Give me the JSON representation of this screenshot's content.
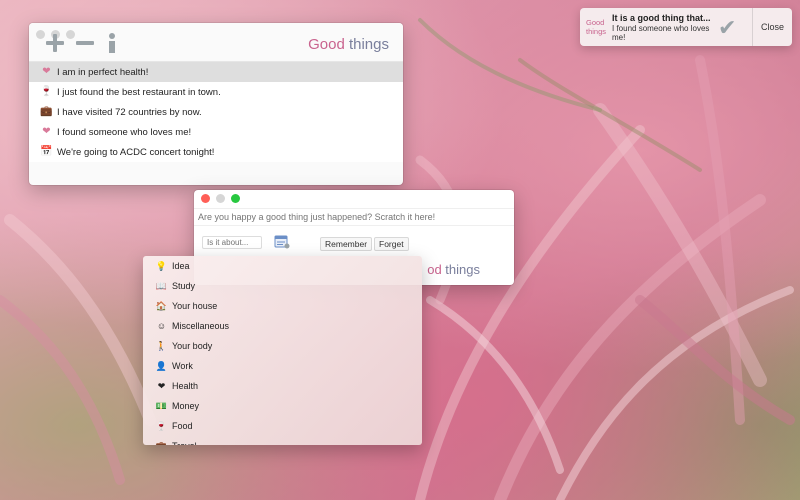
{
  "app": {
    "brand_good": "Good",
    "brand_things": " things"
  },
  "main_window": {
    "entries": [
      {
        "icon": "heart-icon",
        "glyph": "❤",
        "color": "#d97a9a",
        "text": "I am in perfect health!",
        "selected": true
      },
      {
        "icon": "wine-glass-icon",
        "glyph": "🍷",
        "color": "#c9638e",
        "text": "I just found the best restaurant in town.",
        "selected": false
      },
      {
        "icon": "suitcase-icon",
        "glyph": "💼",
        "color": "#c08a90",
        "text": "I have visited 72 countries by now.",
        "selected": false
      },
      {
        "icon": "heart-icon",
        "glyph": "❤",
        "color": "#d97a9a",
        "text": "I found someone who loves me!",
        "selected": false
      },
      {
        "icon": "calendar-icon",
        "glyph": "📅",
        "color": "#6b8fc7",
        "text": "We're going to ACDC concert tonight!",
        "selected": false
      }
    ]
  },
  "add_window": {
    "input_placeholder": "Are you happy a good thing just happened? Scratch it here!",
    "about_placeholder": "Is it about...",
    "remember_label": "Remember",
    "forget_label": "Forget",
    "brand_tail_good": "od",
    "brand_tail_things": " things"
  },
  "dropdown": {
    "items": [
      {
        "icon": "lightbulb-icon",
        "glyph": "💡",
        "label": "Idea"
      },
      {
        "icon": "book-icon",
        "glyph": "📖",
        "label": "Study"
      },
      {
        "icon": "house-icon",
        "glyph": "🏠",
        "label": "Your house"
      },
      {
        "icon": "smiley-icon",
        "glyph": "☺",
        "label": "Miscellaneous"
      },
      {
        "icon": "body-icon",
        "glyph": "🚶",
        "label": "Your body"
      },
      {
        "icon": "worker-icon",
        "glyph": "👤",
        "label": "Work"
      },
      {
        "icon": "heart-icon",
        "glyph": "❤",
        "label": "Health"
      },
      {
        "icon": "money-icon",
        "glyph": "💵",
        "label": "Money"
      },
      {
        "icon": "food-icon",
        "glyph": "🍷",
        "label": "Food"
      },
      {
        "icon": "travel-icon",
        "glyph": "💼",
        "label": "Travel"
      }
    ]
  },
  "notification": {
    "app_line1": "Good",
    "app_line2": "things",
    "title": "It is a good thing that...",
    "body": "I found someone who loves me!",
    "close_label": "Close"
  },
  "colors": {
    "accent_pink": "#c9638e",
    "brand_gray": "#7a7f9c",
    "traffic_red": "#ff5f57",
    "traffic_yellow": "#ffbd2e",
    "traffic_green": "#28c840",
    "traffic_inactive": "#d6d6d6"
  }
}
